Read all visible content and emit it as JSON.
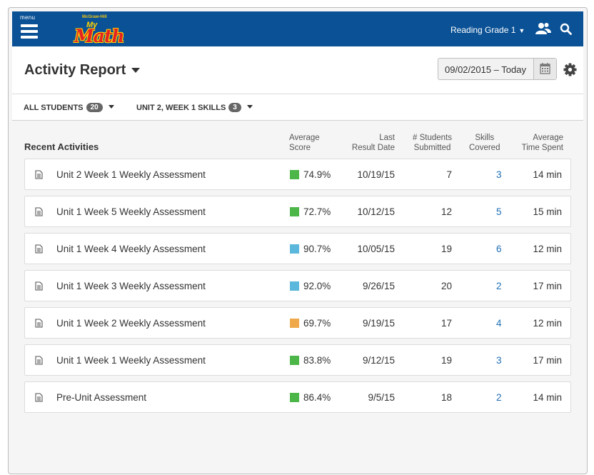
{
  "topbar": {
    "menu_label": "menu",
    "logo_small": "McGraw-Hill",
    "logo_my": "My",
    "logo_math": "Math",
    "grade_selector": "Reading Grade 1"
  },
  "header": {
    "title": "Activity Report",
    "date_range": "09/02/2015 – Today"
  },
  "filters": {
    "students_label": "ALL STUDENTS",
    "students_count": "20",
    "skills_label": "UNIT 2, WEEK 1 SKILLS",
    "skills_count": "3"
  },
  "table": {
    "section_title": "Recent Activities",
    "col_score_1": "Average",
    "col_score_2": "Score",
    "col_date_1": "Last",
    "col_date_2": "Result Date",
    "col_submitted_1": "# Students",
    "col_submitted_2": "Submitted",
    "col_skills_1": "Skills",
    "col_skills_2": "Covered",
    "col_time_1": "Average",
    "col_time_2": "Time Spent",
    "rows": [
      {
        "name": "Unit 2 Week 1 Weekly Assessment",
        "score": "74.9%",
        "score_color": "#4cb648",
        "date": "10/19/15",
        "submitted": "7",
        "skills": "3",
        "time": "14 min"
      },
      {
        "name": "Unit 1 Week 5 Weekly Assessment",
        "score": "72.7%",
        "score_color": "#4cb648",
        "date": "10/12/15",
        "submitted": "12",
        "skills": "5",
        "time": "15 min"
      },
      {
        "name": "Unit 1 Week 4 Weekly Assessment",
        "score": "90.7%",
        "score_color": "#5bb7db",
        "date": "10/05/15",
        "submitted": "19",
        "skills": "6",
        "time": "12 min"
      },
      {
        "name": "Unit 1 Week 3 Weekly Assessment",
        "score": "92.0%",
        "score_color": "#5bb7db",
        "date": "9/26/15",
        "submitted": "20",
        "skills": "2",
        "time": "17 min"
      },
      {
        "name": "Unit 1 Week 2 Weekly Assessment",
        "score": "69.7%",
        "score_color": "#f0a94a",
        "date": "9/19/15",
        "submitted": "17",
        "skills": "4",
        "time": "12 min"
      },
      {
        "name": "Unit 1 Week 1 Weekly Assessment",
        "score": "83.8%",
        "score_color": "#4cb648",
        "date": "9/12/15",
        "submitted": "19",
        "skills": "3",
        "time": "17 min"
      },
      {
        "name": "Pre-Unit Assessment",
        "score": "86.4%",
        "score_color": "#4cb648",
        "date": "9/5/15",
        "submitted": "18",
        "skills": "2",
        "time": "14 min"
      }
    ]
  }
}
